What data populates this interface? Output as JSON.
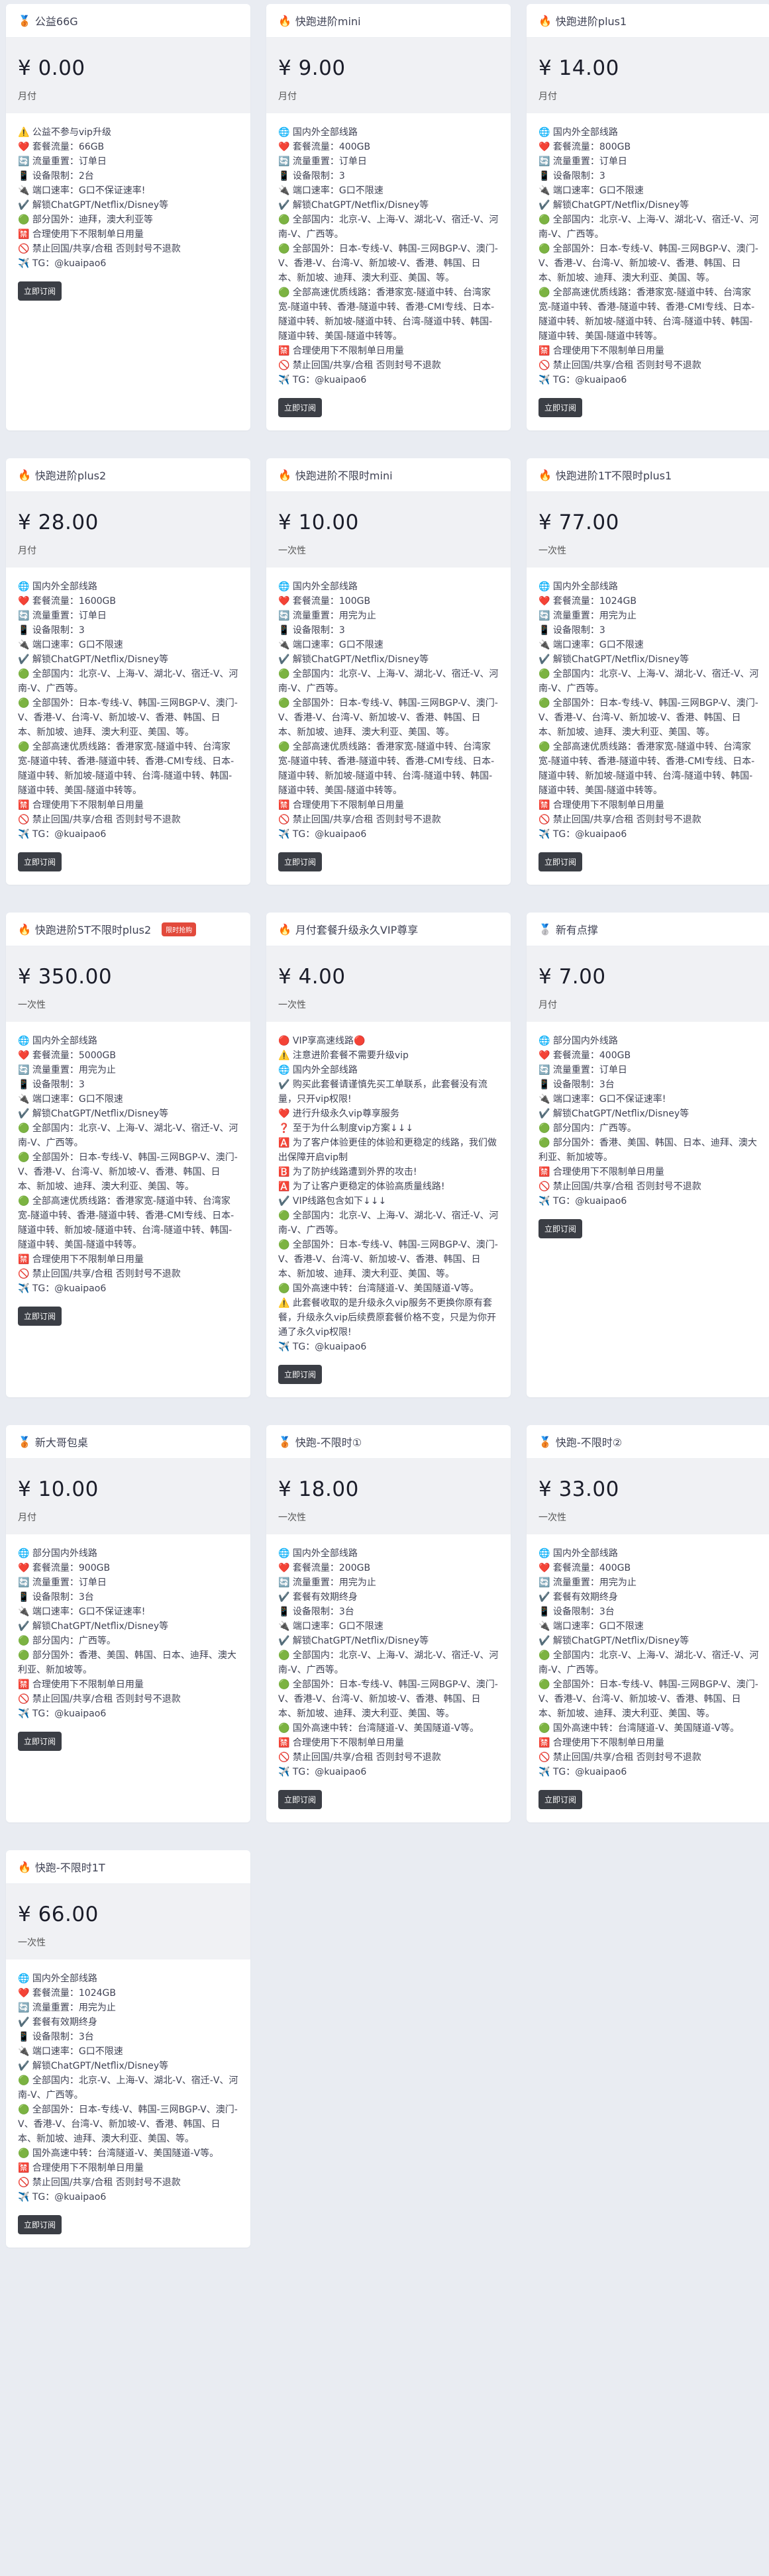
{
  "button_label": "立即订阅",
  "plans": [
    {
      "icon": "🥉",
      "title": "公益66G",
      "badge": "",
      "price": "¥ 0.00",
      "period": "月付",
      "features": [
        "⚠️ 公益不参与vip升级",
        "❤️ 套餐流量：66GB",
        "🔄 流量重置：订单日",
        "📱 设备限制：2台",
        "🔌 端口速率：G口不保证速率!",
        "✔️ 解锁ChatGPT/Netflix/Disney等",
        "🟢 部分国外：迪拜，澳大利亚等",
        "🈲 合理使用下不限制单日用量",
        "🚫 禁止回国/共享/合租 否则封号不退款",
        "✈️ TG：@kuaipao6"
      ]
    },
    {
      "icon": "🔥",
      "title": "快跑进阶mini",
      "badge": "",
      "price": "¥ 9.00",
      "period": "月付",
      "features": [
        "🌐 国内外全部线路",
        "❤️ 套餐流量：400GB",
        "🔄 流量重置：订单日",
        "📱 设备限制：3",
        "🔌 端口速率：G口不限速",
        "✔️ 解锁ChatGPT/Netflix/Disney等",
        "🟢 全部国内：北京-V、上海-V、湖北-V、宿迁-V、河南-V、广西等。",
        "🟢 全部国外：日本-专线-V、韩国-三网BGP-V、澳门-V、香港-V、台湾-V、新加坡-V、香港、韩国、日本、新加坡、迪拜、澳大利亚、美国、等。",
        "🟢 全部高速优质线路：香港家宽-隧道中转、台湾家宽-隧道中转、香港-隧道中转、香港-CMI专线、日本-隧道中转、新加坡-隧道中转、台湾-隧道中转、韩国-隧道中转、美国-隧道中转等。",
        "🈲 合理使用下不限制单日用量",
        "🚫 禁止回国/共享/合租 否则封号不退款",
        "✈️ TG：@kuaipao6"
      ]
    },
    {
      "icon": "🔥",
      "title": "快跑进阶plus1",
      "badge": "",
      "price": "¥ 14.00",
      "period": "月付",
      "features": [
        "🌐 国内外全部线路",
        "❤️ 套餐流量：800GB",
        "🔄 流量重置：订单日",
        "📱 设备限制：3",
        "🔌 端口速率：G口不限速",
        "✔️ 解锁ChatGPT/Netflix/Disney等",
        "🟢 全部国内：北京-V、上海-V、湖北-V、宿迁-V、河南-V、广西等。",
        "🟢 全部国外：日本-专线-V、韩国-三网BGP-V、澳门-V、香港-V、台湾-V、新加坡-V、香港、韩国、日本、新加坡、迪拜、澳大利亚、美国、等。",
        "🟢 全部高速优质线路：香港家宽-隧道中转、台湾家宽-隧道中转、香港-隧道中转、香港-CMI专线、日本-隧道中转、新加坡-隧道中转、台湾-隧道中转、韩国-隧道中转、美国-隧道中转等。",
        "🈲 合理使用下不限制单日用量",
        "🚫 禁止回国/共享/合租 否则封号不退款",
        "✈️ TG：@kuaipao6"
      ]
    },
    {
      "icon": "🔥",
      "title": "快跑进阶plus2",
      "badge": "",
      "price": "¥ 28.00",
      "period": "月付",
      "features": [
        "🌐 国内外全部线路",
        "❤️ 套餐流量：1600GB",
        "🔄 流量重置：订单日",
        "📱 设备限制：3",
        "🔌 端口速率：G口不限速",
        "✔️ 解锁ChatGPT/Netflix/Disney等",
        "🟢 全部国内：北京-V、上海-V、湖北-V、宿迁-V、河南-V、广西等。",
        "🟢 全部国外：日本-专线-V、韩国-三网BGP-V、澳门-V、香港-V、台湾-V、新加坡-V、香港、韩国、日本、新加坡、迪拜、澳大利亚、美国、等。",
        "🟢 全部高速优质线路：香港家宽-隧道中转、台湾家宽-隧道中转、香港-隧道中转、香港-CMI专线、日本-隧道中转、新加坡-隧道中转、台湾-隧道中转、韩国-隧道中转、美国-隧道中转等。",
        "🈲 合理使用下不限制单日用量",
        "🚫 禁止回国/共享/合租 否则封号不退款",
        "✈️ TG：@kuaipao6"
      ]
    },
    {
      "icon": "🔥",
      "title": "快跑进阶不限时mini",
      "badge": "",
      "price": "¥ 10.00",
      "period": "一次性",
      "features": [
        "🌐 国内外全部线路",
        "❤️ 套餐流量：100GB",
        "🔄 流量重置：用完为止",
        "📱 设备限制：3",
        "🔌 端口速率：G口不限速",
        "✔️ 解锁ChatGPT/Netflix/Disney等",
        "🟢 全部国内：北京-V、上海-V、湖北-V、宿迁-V、河南-V、广西等。",
        "🟢 全部国外：日本-专线-V、韩国-三网BGP-V、澳门-V、香港-V、台湾-V、新加坡-V、香港、韩国、日本、新加坡、迪拜、澳大利亚、美国、等。",
        "🟢 全部高速优质线路：香港家宽-隧道中转、台湾家宽-隧道中转、香港-隧道中转、香港-CMI专线、日本-隧道中转、新加坡-隧道中转、台湾-隧道中转、韩国-隧道中转、美国-隧道中转等。",
        "🈲 合理使用下不限制单日用量",
        "🚫 禁止回国/共享/合租 否则封号不退款",
        "✈️ TG：@kuaipao6"
      ]
    },
    {
      "icon": "🔥",
      "title": "快跑进阶1T不限时plus1",
      "badge": "",
      "price": "¥ 77.00",
      "period": "一次性",
      "features": [
        "🌐 国内外全部线路",
        "❤️ 套餐流量：1024GB",
        "🔄 流量重置：用完为止",
        "📱 设备限制：3",
        "🔌 端口速率：G口不限速",
        "✔️ 解锁ChatGPT/Netflix/Disney等",
        "🟢 全部国内：北京-V、上海-V、湖北-V、宿迁-V、河南-V、广西等。",
        "🟢 全部国外：日本-专线-V、韩国-三网BGP-V、澳门-V、香港-V、台湾-V、新加坡-V、香港、韩国、日本、新加坡、迪拜、澳大利亚、美国、等。",
        "🟢 全部高速优质线路：香港家宽-隧道中转、台湾家宽-隧道中转、香港-隧道中转、香港-CMI专线、日本-隧道中转、新加坡-隧道中转、台湾-隧道中转、韩国-隧道中转、美国-隧道中转等。",
        "🈲 合理使用下不限制单日用量",
        "🚫 禁止回国/共享/合租 否则封号不退款",
        "✈️ TG：@kuaipao6"
      ]
    },
    {
      "icon": "🔥",
      "title": "快跑进阶5T不限时plus2",
      "badge": "限时抢购",
      "price": "¥ 350.00",
      "period": "一次性",
      "features": [
        "🌐 国内外全部线路",
        "❤️ 套餐流量：5000GB",
        "🔄 流量重置：用完为止",
        "📱 设备限制：3",
        "🔌 端口速率：G口不限速",
        "✔️ 解锁ChatGPT/Netflix/Disney等",
        "🟢 全部国内：北京-V、上海-V、湖北-V、宿迁-V、河南-V、广西等。",
        "🟢 全部国外：日本-专线-V、韩国-三网BGP-V、澳门-V、香港-V、台湾-V、新加坡-V、香港、韩国、日本、新加坡、迪拜、澳大利亚、美国、等。",
        "🟢 全部高速优质线路：香港家宽-隧道中转、台湾家宽-隧道中转、香港-隧道中转、香港-CMI专线、日本-隧道中转、新加坡-隧道中转、台湾-隧道中转、韩国-隧道中转、美国-隧道中转等。",
        "🈲 合理使用下不限制单日用量",
        "🚫 禁止回国/共享/合租 否则封号不退款",
        "✈️ TG：@kuaipao6"
      ]
    },
    {
      "icon": "🔥",
      "title": "月付套餐升级永久VIP尊享",
      "badge": "",
      "price": "¥ 4.00",
      "period": "一次性",
      "features": [
        "🔴 VIP享高速线路🔴",
        "⚠️ 注意进阶套餐不需要升级vip",
        "🌐 国内外全部线路",
        "✔️ 购买此套餐请谨慎先买工单联系，此套餐没有流量，只开vip权限!",
        "❤️ 进行升级永久vip尊享服务",
        "❓ 至于为什么制度vip方案↓↓↓",
        "🅰️ 为了客户体验更佳的体验和更稳定的线路，我们做出保障开启vip制",
        "🅱️ 为了防护线路遭到外界的攻击!",
        "🅰️ 为了让客户更稳定的体验高质量线路!",
        "✔️ VIP线路包含如下↓↓↓",
        "🟢 全部国内：北京-V、上海-V、湖北-V、宿迁-V、河南-V、广西等。",
        "🟢 全部国外：日本-专线-V、韩国-三网BGP-V、澳门-V、香港-V、台湾-V、新加坡-V、香港、韩国、日本、新加坡、迪拜、澳大利亚、美国、等。",
        "🟢 国外高速中转：台湾隧道-V、美国隧道-V等。",
        "⚠️ 此套餐收取的是升级永久vip服务不更换你原有套餐，升级永久vip后续费原套餐价格不变，只是为你开通了永久vip权限!",
        "✈️ TG：@kuaipao6"
      ]
    },
    {
      "icon": "🥈",
      "title": "新有点撑",
      "badge": "",
      "price": "¥ 7.00",
      "period": "月付",
      "features": [
        "🌐 部分国内外线路",
        "❤️ 套餐流量：400GB",
        "🔄 流量重置：订单日",
        "📱 设备限制：3台",
        "🔌 端口速率：G口不保证速率!",
        "✔️ 解锁ChatGPT/Netflix/Disney等",
        "🟢 部分国内：广西等。",
        "🟢 部分国外：香港、美国、韩国、日本、迪拜、澳大利亚、新加坡等。",
        "🈲 合理使用下不限制单日用量",
        "🚫 禁止回国/共享/合租 否则封号不退款",
        "✈️ TG：@kuaipao6"
      ]
    },
    {
      "icon": "🥉",
      "title": "新大哥包桌",
      "badge": "",
      "price": "¥ 10.00",
      "period": "月付",
      "features": [
        "🌐 部分国内外线路",
        "❤️ 套餐流量：900GB",
        "🔄 流量重置：订单日",
        "📱 设备限制：3台",
        "🔌 端口速率：G口不保证速率!",
        "✔️ 解锁ChatGPT/Netflix/Disney等",
        "🟢 部分国内：广西等。",
        "🟢 部分国外：香港、美国、韩国、日本、迪拜、澳大利亚、新加坡等。",
        "🈲 合理使用下不限制单日用量",
        "🚫 禁止回国/共享/合租 否则封号不退款",
        "✈️ TG：@kuaipao6"
      ]
    },
    {
      "icon": "🥉",
      "title": "快跑-不限时①",
      "badge": "",
      "price": "¥ 18.00",
      "period": "一次性",
      "features": [
        "🌐 国内外全部线路",
        "❤️ 套餐流量：200GB",
        "🔄 流量重置：用完为止",
        "✔️ 套餐有效期终身",
        "📱 设备限制：3台",
        "🔌 端口速率：G口不限速",
        "✔️ 解锁ChatGPT/Netflix/Disney等",
        "🟢 全部国内：北京-V、上海-V、湖北-V、宿迁-V、河南-V、广西等。",
        "🟢 全部国外：日本-专线-V、韩国-三网BGP-V、澳门-V、香港-V、台湾-V、新加坡-V、香港、韩国、日本、新加坡、迪拜、澳大利亚、美国、等。",
        "🟢 国外高速中转：台湾隧道-V、美国隧道-V等。",
        "🈲 合理使用下不限制单日用量",
        "🚫 禁止回国/共享/合租 否则封号不退款",
        "✈️ TG：@kuaipao6"
      ]
    },
    {
      "icon": "🥉",
      "title": "快跑-不限时②",
      "badge": "",
      "price": "¥ 33.00",
      "period": "一次性",
      "features": [
        "🌐 国内外全部线路",
        "❤️ 套餐流量：400GB",
        "🔄 流量重置：用完为止",
        "✔️ 套餐有效期终身",
        "📱 设备限制：3台",
        "🔌 端口速率：G口不限速",
        "✔️ 解锁ChatGPT/Netflix/Disney等",
        "🟢 全部国内：北京-V、上海-V、湖北-V、宿迁-V、河南-V、广西等。",
        "🟢 全部国外：日本-专线-V、韩国-三网BGP-V、澳门-V、香港-V、台湾-V、新加坡-V、香港、韩国、日本、新加坡、迪拜、澳大利亚、美国、等。",
        "🟢 国外高速中转：台湾隧道-V、美国隧道-V等。",
        "🈲 合理使用下不限制单日用量",
        "🚫 禁止回国/共享/合租 否则封号不退款",
        "✈️ TG：@kuaipao6"
      ]
    },
    {
      "icon": "🔥",
      "title": "快跑-不限时1T",
      "badge": "",
      "price": "¥ 66.00",
      "period": "一次性",
      "features": [
        "🌐 国内外全部线路",
        "❤️ 套餐流量：1024GB",
        "🔄 流量重置：用完为止",
        "✔️ 套餐有效期终身",
        "📱 设备限制：3台",
        "🔌 端口速率：G口不限速",
        "✔️ 解锁ChatGPT/Netflix/Disney等",
        "🟢 全部国内：北京-V、上海-V、湖北-V、宿迁-V、河南-V、广西等。",
        "🟢 全部国外：日本-专线-V、韩国-三网BGP-V、澳门-V、香港-V、台湾-V、新加坡-V、香港、韩国、日本、新加坡、迪拜、澳大利亚、美国、等。",
        "🟢 国外高速中转：台湾隧道-V、美国隧道-V等。",
        "🈲 合理使用下不限制单日用量",
        "🚫 禁止回国/共享/合租 否则封号不退款",
        "✈️ TG：@kuaipao6"
      ]
    }
  ]
}
